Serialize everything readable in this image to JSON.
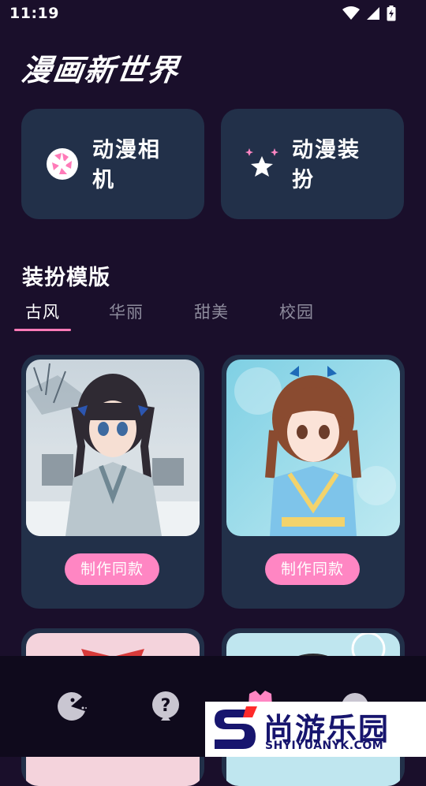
{
  "status": {
    "time": "11:19"
  },
  "app": {
    "title": "漫画新世界"
  },
  "features": [
    {
      "label": "动漫相机",
      "icon": "camera-aperture-icon"
    },
    {
      "label": "动漫装扮",
      "icon": "sparkle-star-icon"
    }
  ],
  "section": {
    "title": "装扮模版"
  },
  "tabs": [
    {
      "label": "古风",
      "active": true
    },
    {
      "label": "华丽",
      "active": false
    },
    {
      "label": "甜美",
      "active": false
    },
    {
      "label": "校园",
      "active": false
    }
  ],
  "templates": [
    {
      "button": "制作同款",
      "image": "ancient-style-girl-snow"
    },
    {
      "button": "制作同款",
      "image": "sweet-girl-blue-dress"
    },
    {
      "button": "",
      "image": "pink-girl-red-bow"
    },
    {
      "button": "",
      "image": "snowflake-girl"
    }
  ],
  "nav": [
    {
      "icon": "pacman-icon"
    },
    {
      "icon": "help-icon"
    },
    {
      "icon": "dress-icon"
    },
    {
      "icon": "profile-icon"
    }
  ],
  "watermark": {
    "main": "尚游乐园",
    "sub": "SHYIYUANYK.COM"
  },
  "colors": {
    "background": "#1a0f2b",
    "card": "#223049",
    "accent": "#ff86c3"
  }
}
